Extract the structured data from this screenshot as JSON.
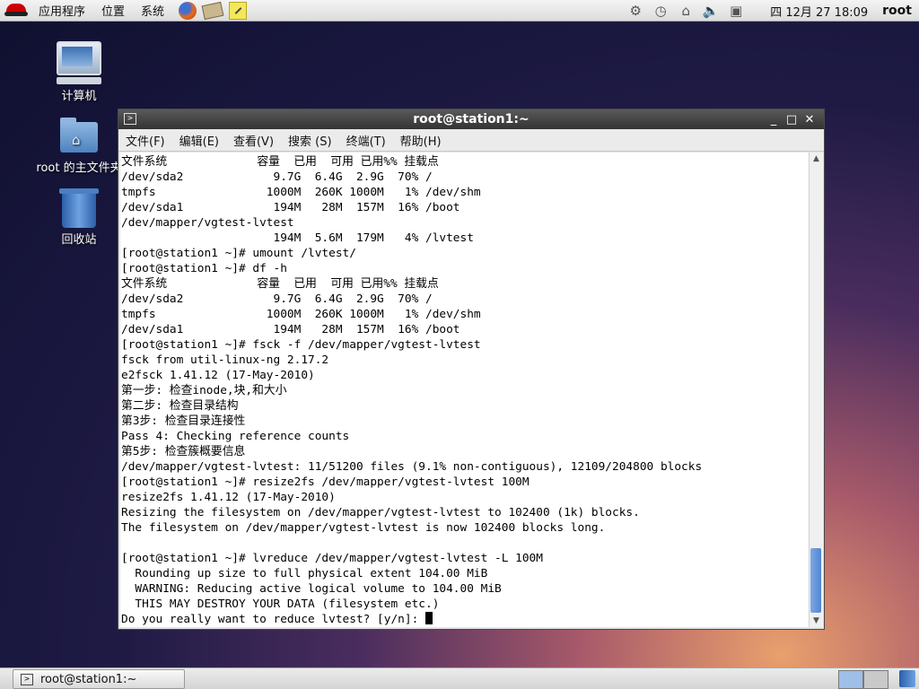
{
  "top_panel": {
    "menus": [
      "应用程序",
      "位置",
      "系统"
    ],
    "launchers": [
      "firefox-icon",
      "mail-icon",
      "notes-icon"
    ],
    "tray_icons": [
      "network-settings-icon",
      "clock-app-icon",
      "network-icon",
      "volume-icon",
      "display-icon"
    ],
    "clock": "四 12月 27 18:09",
    "user": "root"
  },
  "desktop": {
    "icons": [
      {
        "label": "计算机",
        "icon": "computer-icon"
      },
      {
        "label": "root 的主文件夹",
        "icon": "home-folder-icon"
      },
      {
        "label": "回收站",
        "icon": "trash-icon"
      }
    ]
  },
  "terminal": {
    "title": "root@station1:~",
    "menu": [
      "文件(F)",
      "编辑(E)",
      "查看(V)",
      "搜索 (S)",
      "终端(T)",
      "帮助(H)"
    ],
    "lines": [
      "文件系统             容量  已用  可用 已用%% 挂载点",
      "/dev/sda2             9.7G  6.4G  2.9G  70% /",
      "tmpfs                1000M  260K 1000M   1% /dev/shm",
      "/dev/sda1             194M   28M  157M  16% /boot",
      "/dev/mapper/vgtest-lvtest",
      "                      194M  5.6M  179M   4% /lvtest",
      "[root@station1 ~]# umount /lvtest/",
      "[root@station1 ~]# df -h",
      "文件系统             容量  已用  可用 已用%% 挂载点",
      "/dev/sda2             9.7G  6.4G  2.9G  70% /",
      "tmpfs                1000M  260K 1000M   1% /dev/shm",
      "/dev/sda1             194M   28M  157M  16% /boot",
      "[root@station1 ~]# fsck -f /dev/mapper/vgtest-lvtest",
      "fsck from util-linux-ng 2.17.2",
      "e2fsck 1.41.12 (17-May-2010)",
      "第一步: 检查inode,块,和大小",
      "第二步: 检查目录结构",
      "第3步: 检查目录连接性",
      "Pass 4: Checking reference counts",
      "第5步: 检查簇概要信息",
      "/dev/mapper/vgtest-lvtest: 11/51200 files (9.1% non-contiguous), 12109/204800 blocks",
      "[root@station1 ~]# resize2fs /dev/mapper/vgtest-lvtest 100M",
      "resize2fs 1.41.12 (17-May-2010)",
      "Resizing the filesystem on /dev/mapper/vgtest-lvtest to 102400 (1k) blocks.",
      "The filesystem on /dev/mapper/vgtest-lvtest is now 102400 blocks long.",
      "",
      "[root@station1 ~]# lvreduce /dev/mapper/vgtest-lvtest -L 100M",
      "  Rounding up size to full physical extent 104.00 MiB",
      "  WARNING: Reducing active logical volume to 104.00 MiB",
      "  THIS MAY DESTROY YOUR DATA (filesystem etc.)"
    ],
    "prompt": "Do you really want to reduce lvtest? [y/n]: ",
    "scroll_position": 1.0
  },
  "taskbar": {
    "tasks": [
      {
        "label": "root@station1:~",
        "icon": "terminal-icon"
      }
    ],
    "workspaces": 2,
    "active_workspace": 1
  }
}
